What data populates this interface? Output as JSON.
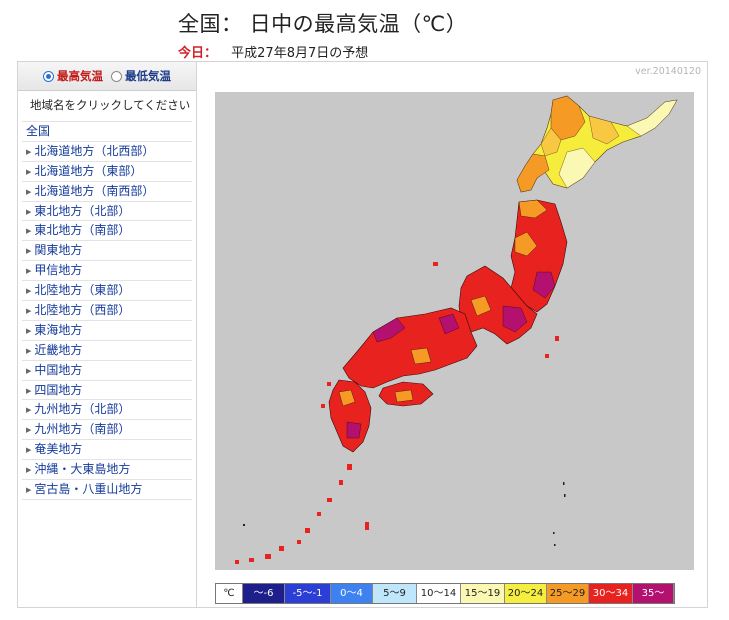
{
  "header": {
    "title": "全国： 日中の最高気温（℃）",
    "today_label": "今日：",
    "date": "平成27年8月7日の予想"
  },
  "toggle": {
    "max_label": "最高気温",
    "min_label": "最低気温",
    "selected": "max"
  },
  "sidebar": {
    "hint": "地域名をクリックしてください",
    "regions": [
      "全国",
      "北海道地方（北西部）",
      "北海道地方（東部）",
      "北海道地方（南西部）",
      "東北地方（北部）",
      "東北地方（南部）",
      "関東地方",
      "甲信地方",
      "北陸地方（東部）",
      "北陸地方（西部）",
      "東海地方",
      "近畿地方",
      "中国地方",
      "四国地方",
      "九州地方（北部）",
      "九州地方（南部）",
      "奄美地方",
      "沖縄・大東島地方",
      "宮古島・八重山地方"
    ]
  },
  "version": "ver.20140120",
  "legend": {
    "unit": "℃",
    "bins": [
      {
        "label": "〜-6",
        "bg": "#1f1f8c",
        "fg": "#ffffff"
      },
      {
        "label": "-5〜-1",
        "bg": "#2b3fd6",
        "fg": "#ffffff"
      },
      {
        "label": "0〜4",
        "bg": "#3d82f0",
        "fg": "#ffffff"
      },
      {
        "label": "5〜9",
        "bg": "#bfe6fb",
        "fg": "#222222"
      },
      {
        "label": "10〜14",
        "bg": "#ffffff",
        "fg": "#222222"
      },
      {
        "label": "15〜19",
        "bg": "#fbf8b4",
        "fg": "#222222"
      },
      {
        "label": "20〜24",
        "bg": "#f6ee3e",
        "fg": "#222222"
      },
      {
        "label": "25〜29",
        "bg": "#f59b25",
        "fg": "#222222"
      },
      {
        "label": "30〜34",
        "bg": "#e8231f",
        "fg": "#ffffff"
      },
      {
        "label": "35〜",
        "bg": "#b3106f",
        "fg": "#ffffff"
      }
    ]
  }
}
